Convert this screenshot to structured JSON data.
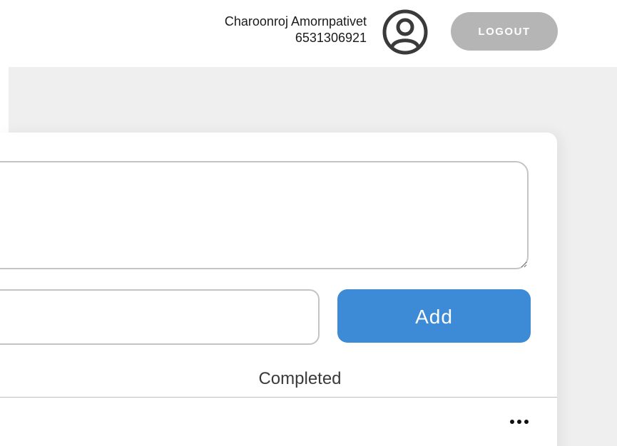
{
  "header": {
    "user_name": "Charoonroj Amornpativet",
    "user_id": "6531306921",
    "avatar_icon": "user-circle-icon",
    "logout_label": "LOGOUT"
  },
  "form": {
    "textarea_value": "",
    "input_value": "",
    "add_label": "Add"
  },
  "tabs": {
    "completed_label": "Completed"
  },
  "list": {
    "more_icon": "more-horizontal-icon"
  },
  "colors": {
    "accent": "#3d8bd6",
    "logout_bg": "#b5b5b5",
    "page_bg": "#efefef"
  }
}
